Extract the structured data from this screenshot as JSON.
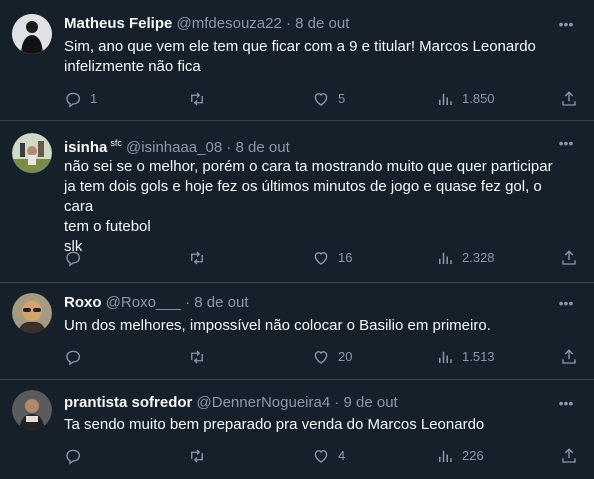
{
  "tweets": [
    {
      "name": "Matheus Felipe",
      "handle": "@mfdesouza22",
      "dot": "·",
      "date": "8 de out",
      "lines": [
        "Sim, ano que vem ele tem que ficar com a 9 e titular! Marcos Leonardo",
        "infelizmente não fica"
      ],
      "replies": "1",
      "retweets": "",
      "likes": "5",
      "views": "1.850"
    },
    {
      "name": "isinha",
      "badge": "sfc",
      "handle": "@isinhaaa_08",
      "dot": "·",
      "date": "8 de out",
      "lines": [
        "não sei se o melhor, porém o cara ta mostrando muito que quer participar",
        "ja tem dois gols e hoje fez os últimos minutos de jogo e quase fez gol, o cara",
        "tem o futebol",
        "slk"
      ],
      "replies": "",
      "retweets": "",
      "likes": "16",
      "views": "2.328"
    },
    {
      "name": "Roxo",
      "handle": "@Roxo___",
      "dot": "·",
      "date": "8 de out",
      "lines": [
        "Um dos melhores, impossível não colocar o Basilio em primeiro."
      ],
      "replies": "",
      "retweets": "",
      "likes": "20",
      "views": "1.513"
    },
    {
      "name": "prantista sofredor",
      "handle": "@DennerNogueira4",
      "dot": "·",
      "date": "9 de out",
      "lines": [
        "Ta sendo muito bem preparado pra venda do Marcos Leonardo"
      ],
      "replies": "",
      "retweets": "",
      "likes": "4",
      "views": "226"
    }
  ],
  "icons": {
    "more": "more-icon",
    "reply": "reply-icon",
    "retweet": "retweet-icon",
    "like": "like-icon",
    "views": "views-icon",
    "share": "share-icon"
  },
  "colors": {
    "background": "#15202b",
    "text": "#f7f9f9",
    "secondary": "#8b98a5",
    "divider": "#38444d"
  }
}
